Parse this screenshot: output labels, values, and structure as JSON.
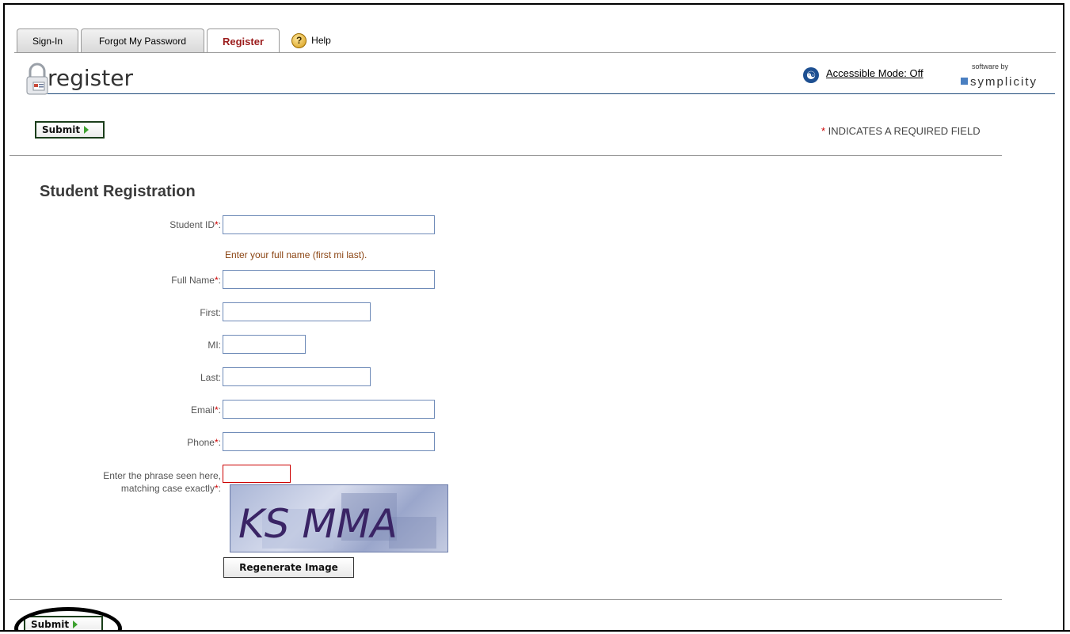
{
  "tabs": [
    {
      "label": "Sign-In",
      "active": false
    },
    {
      "label": "Forgot My Password",
      "active": false
    },
    {
      "label": "Register",
      "active": true
    },
    {
      "label": "Help",
      "active": false,
      "icon": "help-icon"
    }
  ],
  "header": {
    "title": "register",
    "accessible_mode": "Accessible Mode: Off",
    "vendor_prefix": "software by",
    "vendor_name": "symplicity"
  },
  "toolbar": {
    "submit_label": "Submit",
    "required_star": "*",
    "required_note": " INDICATES A REQUIRED FIELD"
  },
  "form": {
    "section_title": "Student Registration",
    "student_id_label": "Student ID",
    "name_hint": "Enter your full name (first mi last).",
    "full_name_label": "Full Name",
    "first_label": "First:",
    "mi_label": "MI:",
    "last_label": "Last:",
    "email_label": "Email",
    "phone_label": "Phone",
    "captcha_label_line1": "Enter the phrase seen here,",
    "captcha_label_line2": "matching case exactly",
    "required_star": "*",
    "colon": ":",
    "captcha_text": "KS MMA",
    "regenerate_label": "Regenerate Image",
    "values": {
      "student_id": "",
      "full_name": "",
      "first": "",
      "mi": "",
      "last": "",
      "email": "",
      "phone": "",
      "captcha": ""
    }
  },
  "colors": {
    "accent": "#9b1c1c",
    "required": "#cc0000",
    "hint": "#8b4513",
    "link_blue": "#1d4f91",
    "submit_arrow": "#3da12f"
  }
}
